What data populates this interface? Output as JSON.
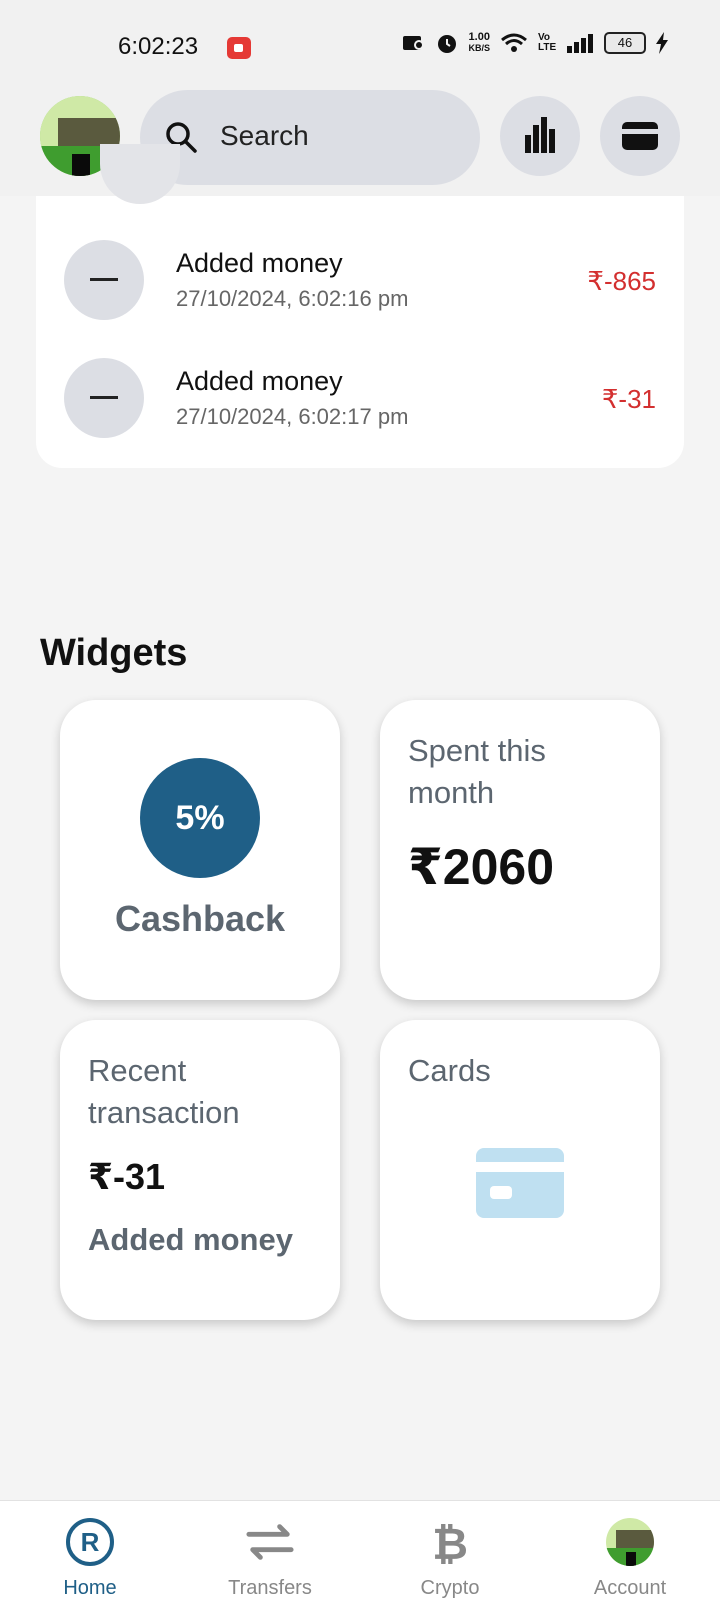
{
  "status_bar": {
    "time": "6:02:23",
    "speed_value": "1.00",
    "speed_unit": "KB/S",
    "network": "Vo LTE",
    "battery": "46"
  },
  "header": {
    "search_placeholder": "Search"
  },
  "transactions": [
    {
      "title": "Added money",
      "date": "27/10/2024, 6:02:16 pm",
      "amount": "₹-865"
    },
    {
      "title": "Added money",
      "date": "27/10/2024, 6:02:17 pm",
      "amount": "₹-31"
    }
  ],
  "widgets": {
    "title": "Widgets",
    "cashback": {
      "percent": "5%",
      "label": "Cashback"
    },
    "spent": {
      "label": "Spent this month",
      "amount": "₹2060"
    },
    "recent": {
      "label": "Recent transaction",
      "amount": "₹-31",
      "description": "Added money"
    },
    "cards": {
      "label": "Cards"
    }
  },
  "bottom_nav": [
    {
      "label": "Home",
      "icon": "registered-icon",
      "active": true
    },
    {
      "label": "Transfers",
      "icon": "transfer-arrows-icon",
      "active": false
    },
    {
      "label": "Crypto",
      "icon": "bitcoin-icon",
      "active": false
    },
    {
      "label": "Account",
      "icon": "avatar",
      "active": false
    }
  ],
  "colors": {
    "accent": "#1f5f87",
    "negative_amount": "#d32f2f",
    "card_graphic": "#bfe0f1"
  }
}
